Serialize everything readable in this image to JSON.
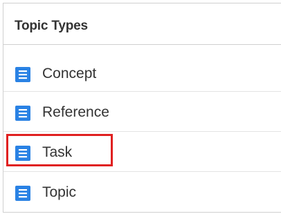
{
  "panel": {
    "title": "Topic Types"
  },
  "topics": [
    {
      "label": "Concept",
      "icon": "document-icon"
    },
    {
      "label": "Reference",
      "icon": "document-icon"
    },
    {
      "label": "Task",
      "icon": "document-icon",
      "highlighted": true
    },
    {
      "label": "Topic",
      "icon": "document-icon"
    }
  ],
  "colors": {
    "icon": "#2a82e4",
    "highlight": "#e02020",
    "text": "#333333"
  }
}
